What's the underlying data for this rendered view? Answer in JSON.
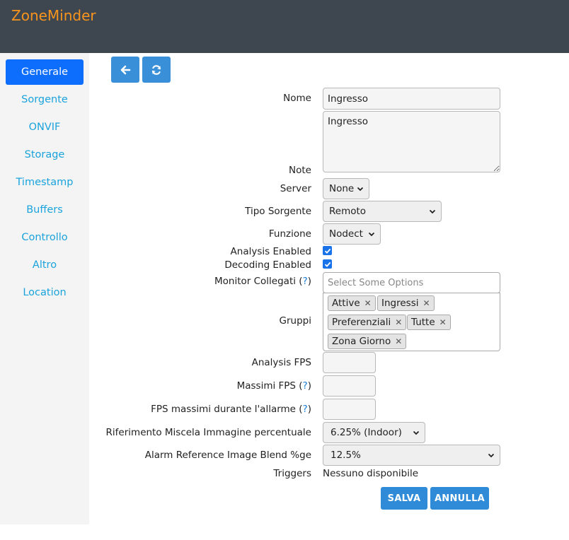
{
  "app": {
    "brand": "ZoneMinder"
  },
  "toolbar": {
    "back_icon": "arrow-left-icon",
    "refresh_icon": "refresh-icon"
  },
  "sidebar": {
    "items": [
      {
        "label": "Generale",
        "active": true
      },
      {
        "label": "Sorgente"
      },
      {
        "label": "ONVIF"
      },
      {
        "label": "Storage"
      },
      {
        "label": "Timestamp"
      },
      {
        "label": "Buffers"
      },
      {
        "label": "Controllo"
      },
      {
        "label": "Altro"
      },
      {
        "label": "Location"
      }
    ]
  },
  "form": {
    "name_label": "Nome",
    "name_value": "Ingresso",
    "notes_label": "Note",
    "notes_value": "Ingresso",
    "server_label": "Server",
    "server_value": "None",
    "source_type_label": "Tipo Sorgente",
    "source_type_value": "Remoto",
    "function_label": "Funzione",
    "function_value": "Nodect",
    "analysis_enabled_label": "Analysis Enabled",
    "analysis_enabled": true,
    "decoding_enabled_label": "Decoding Enabled",
    "decoding_enabled": true,
    "linked_monitors_label": "Monitor Collegati (",
    "linked_monitors_help": "?",
    "linked_monitors_close": ")",
    "linked_monitors_placeholder": "Select Some Options",
    "groups_label": "Gruppi",
    "groups": [
      "Attive",
      "Ingressi",
      "Preferenziali",
      "Tutte",
      "Zona Giorno"
    ],
    "analysis_fps_label": "Analysis FPS",
    "max_fps_label": "Massimi FPS (",
    "max_fps_help": "?",
    "max_fps_close": ")",
    "alarm_max_fps_label": "FPS massimi durante l'allarme (",
    "alarm_max_fps_help": "?",
    "alarm_max_fps_close": ")",
    "ref_blend_label": "Riferimento Miscela Immagine percentuale",
    "ref_blend_value": "6.25% (Indoor)",
    "alarm_ref_blend_label": "Alarm Reference Image Blend %ge",
    "alarm_ref_blend_value": "12.5%",
    "triggers_label": "Triggers",
    "triggers_value": "Nessuno disponibile"
  },
  "actions": {
    "save": "SALVA",
    "cancel": "ANNULLA"
  },
  "colors": {
    "topbar": "#3e4650",
    "brand": "#f7941d",
    "accent": "#0d6efd",
    "button": "#2f8bd8",
    "link": "#1aa3dc"
  }
}
